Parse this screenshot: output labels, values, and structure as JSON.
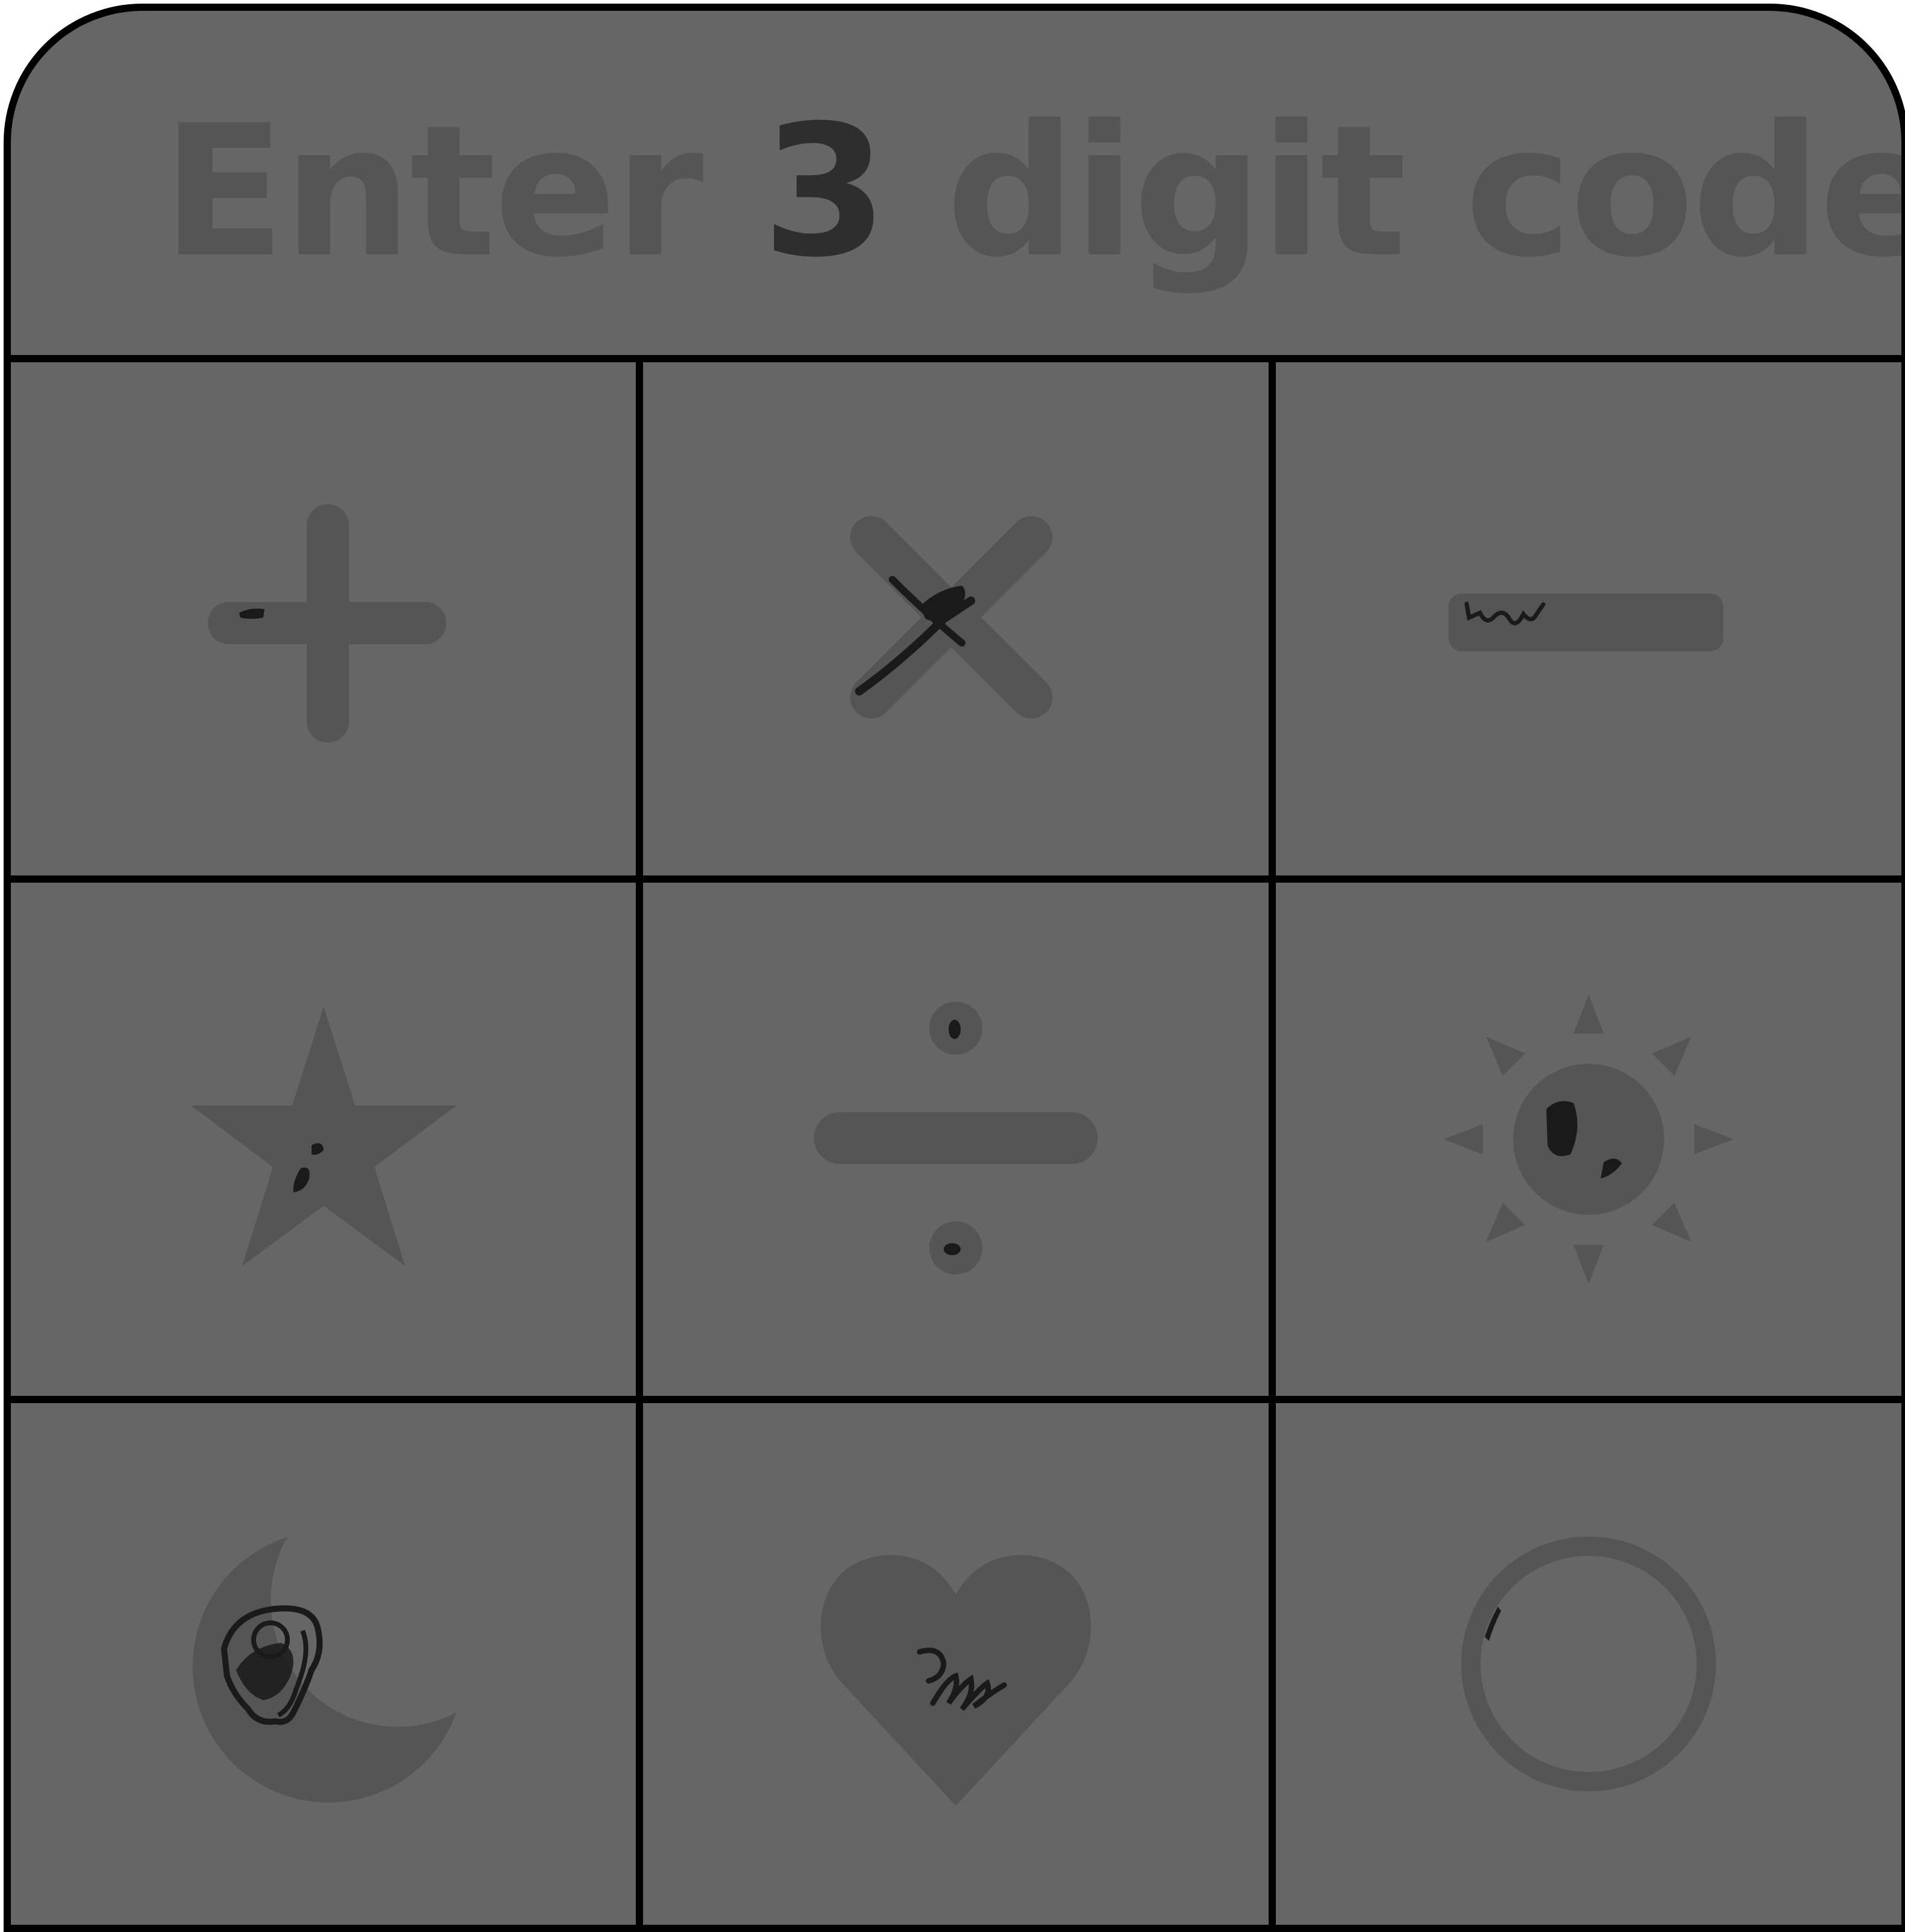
{
  "header": {
    "title_prefix": "Enter",
    "title_digit": "3",
    "title_suffix": "digit code"
  },
  "colors": {
    "panel_background": "#666666",
    "symbol_fill": "#555555",
    "title_digit": "#2e2e2e",
    "grid_lines": "#000000",
    "scribble": "#1a1a1a"
  },
  "tiles": [
    {
      "icon": "plus-icon"
    },
    {
      "icon": "multiply-icon"
    },
    {
      "icon": "minus-icon"
    },
    {
      "icon": "star-icon"
    },
    {
      "icon": "divide-icon"
    },
    {
      "icon": "sun-icon"
    },
    {
      "icon": "moon-icon"
    },
    {
      "icon": "heart-icon"
    },
    {
      "icon": "circle-icon"
    }
  ]
}
